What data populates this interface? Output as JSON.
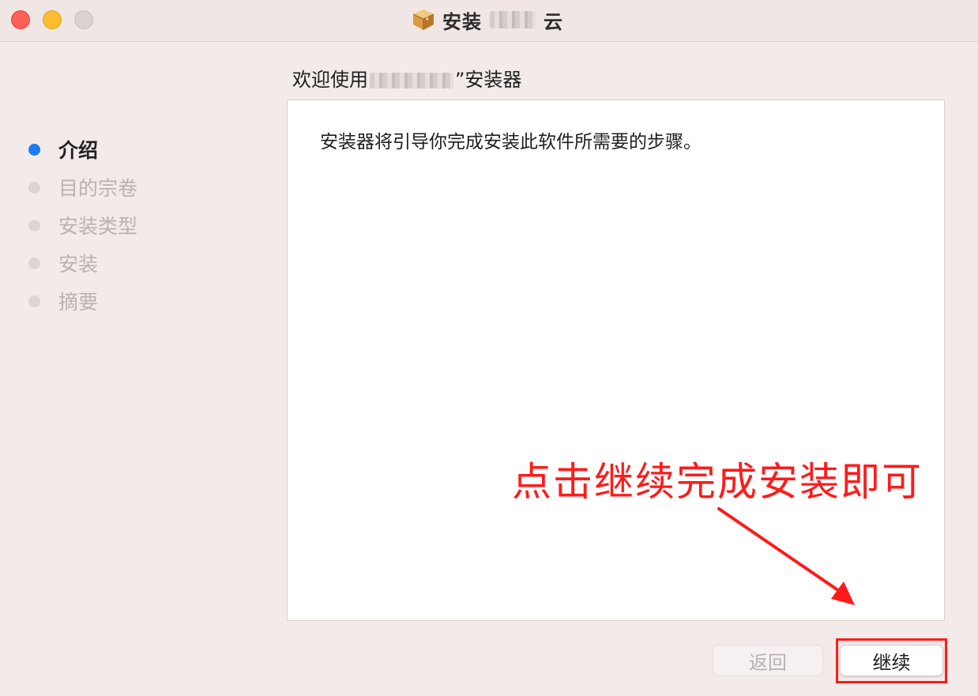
{
  "window": {
    "title_prefix": "安装",
    "title_suffix": "云",
    "icon": "package-icon"
  },
  "header": {
    "welcome_prefix": "欢迎使用",
    "welcome_suffix": "”安装器"
  },
  "sidebar": {
    "steps": [
      {
        "label": "介绍",
        "active": true
      },
      {
        "label": "目的宗卷",
        "active": false
      },
      {
        "label": "安装类型",
        "active": false
      },
      {
        "label": "安装",
        "active": false
      },
      {
        "label": "摘要",
        "active": false
      }
    ]
  },
  "content": {
    "intro_text": "安装器将引导你完成安装此软件所需要的步骤。"
  },
  "annotation": {
    "text": "点击继续完成安装即可",
    "color": "#ff1a1a"
  },
  "footer": {
    "back_label": "返回",
    "continue_label": "继续"
  },
  "colors": {
    "accent": "#1b7cf5",
    "close": "#fe5f57",
    "minimize": "#febc2e",
    "zoom": "#d9d2d0"
  }
}
